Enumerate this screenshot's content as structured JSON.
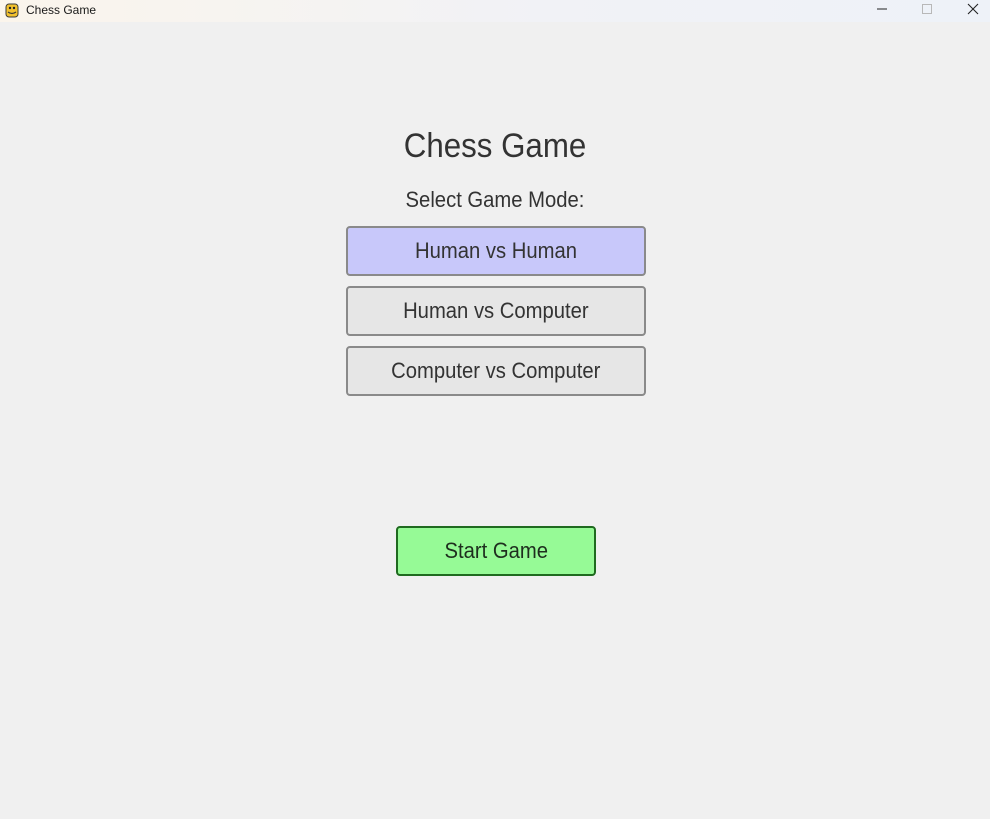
{
  "window": {
    "title": "Chess Game"
  },
  "main": {
    "heading": "Chess Game",
    "prompt": "Select Game Mode:",
    "modes": [
      {
        "label": "Human vs Human",
        "selected": true
      },
      {
        "label": "Human vs Computer",
        "selected": false
      },
      {
        "label": "Computer vs Computer",
        "selected": false
      }
    ],
    "start_label": "Start Game"
  },
  "colors": {
    "background": "#f0f0f0",
    "mode_selected": "#c8c8fa",
    "mode_default": "#e6e6e6",
    "start_button": "#96fa96",
    "start_border": "#1f6a1f"
  },
  "icons": {
    "app": "python-snake-icon",
    "minimize": "minimize-icon",
    "maximize": "maximize-icon",
    "close": "close-icon"
  }
}
